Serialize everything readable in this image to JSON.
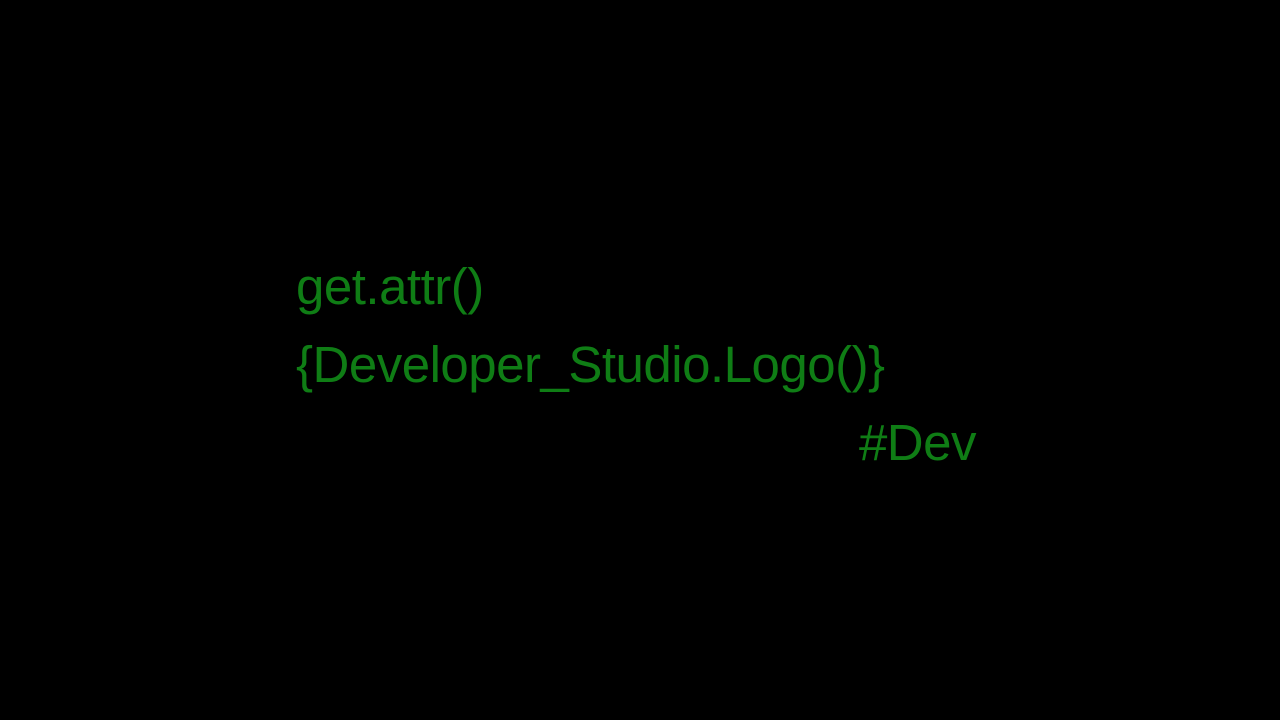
{
  "lines": {
    "line1": "get.attr()",
    "line2": "{Developer_Studio.Logo()}",
    "line3": "#Dev"
  },
  "colors": {
    "background": "#000000",
    "text": "#0f7d15"
  }
}
